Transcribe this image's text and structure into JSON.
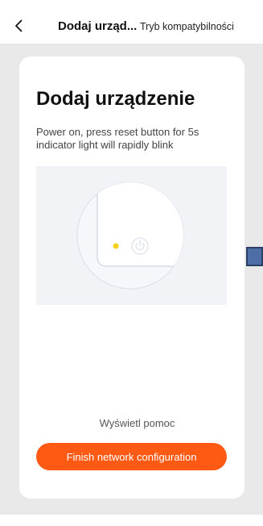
{
  "header": {
    "back_icon": "chevron-left-icon",
    "title": "Dodaj urząd...",
    "compat_link": "Tryb kompatybilności"
  },
  "card": {
    "title": "Dodaj urządzenie",
    "description": "Power on, press reset button for 5s indicator light will rapidly blink",
    "illustration": {
      "indicator_color": "#f2d21c",
      "power_icon": "power-icon"
    }
  },
  "actions": {
    "help_link": "Wyświetl pomoc",
    "finish_label": "Finish network configuration"
  },
  "colors": {
    "accent": "#ff5a13",
    "page_background": "#e9e9e9",
    "card_background": "#ffffff"
  }
}
